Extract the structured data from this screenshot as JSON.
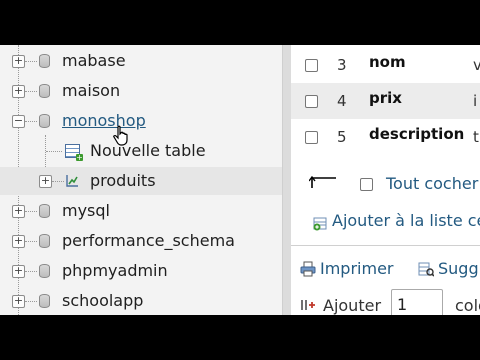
{
  "tree": {
    "databases": [
      {
        "label": "mabase"
      },
      {
        "label": "maison"
      },
      {
        "label": "monoshop"
      },
      {
        "label": "mysql"
      },
      {
        "label": "performance_schema"
      },
      {
        "label": "phpmyadmin"
      },
      {
        "label": "schoolapp"
      }
    ],
    "children": [
      {
        "label": "Nouvelle table",
        "icon": "new-table-icon"
      },
      {
        "label": "produits",
        "icon": "table-structure-icon"
      }
    ]
  },
  "columns": [
    {
      "num": "3",
      "name": "nom",
      "trail": "v"
    },
    {
      "num": "4",
      "name": "prix",
      "trail": "i"
    },
    {
      "num": "5",
      "name": "description",
      "trail": "t"
    }
  ],
  "bulk": {
    "check_all": "Tout cocher"
  },
  "add_to_list": "Ajouter à la liste ce",
  "actions": {
    "print": "Imprimer",
    "suggest": "Sugg"
  },
  "add_row": {
    "label": "Ajouter",
    "value": "1",
    "trail": "colo"
  },
  "colors": {
    "link": "#235a81",
    "tree_bg": "#f3f3f3",
    "row_alt": "#ececec"
  }
}
